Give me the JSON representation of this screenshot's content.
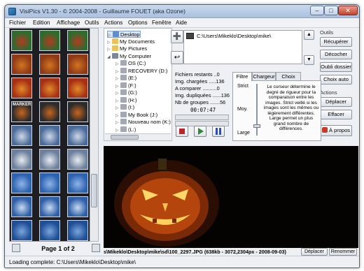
{
  "window": {
    "title": "VisiPics V1.30 - © 2004-2008 - Guillaume FOUET (aka Ozone)",
    "minimize": "–",
    "maximize": "□",
    "close": "✕"
  },
  "menu": [
    "Fichier",
    "Edition",
    "Affichage",
    "Outils",
    "Actions",
    "Options",
    "Fenêtre",
    "Aide"
  ],
  "thumbnails": {
    "marker_label": "MARKER",
    "page_label": "Page 1 of 2"
  },
  "tree": {
    "items": [
      {
        "label": "Desktop",
        "icon": "desktop-icon",
        "color": "#5b8fcf"
      },
      {
        "label": "My Documents",
        "icon": "folder-icon",
        "color": "#e9c45a"
      },
      {
        "label": "My Pictures",
        "icon": "folder-icon",
        "color": "#e9c45a"
      },
      {
        "label": "My Computer",
        "icon": "computer-icon",
        "color": "#7a8797"
      },
      {
        "label": "OS (C:)",
        "icon": "drive-icon",
        "color": "#a2a9b3"
      },
      {
        "label": "RECOVERY (D:)",
        "icon": "drive-icon",
        "color": "#a2a9b3"
      },
      {
        "label": "(E:)",
        "icon": "drive-icon",
        "color": "#a2a9b3"
      },
      {
        "label": "(F:)",
        "icon": "drive-icon",
        "color": "#a2a9b3"
      },
      {
        "label": "(G:)",
        "icon": "drive-icon",
        "color": "#a2a9b3"
      },
      {
        "label": "(H:)",
        "icon": "drive-icon",
        "color": "#a2a9b3"
      },
      {
        "label": "(I:)",
        "icon": "drive-icon",
        "color": "#a2a9b3"
      },
      {
        "label": "My Book (J:)",
        "icon": "drive-icon",
        "color": "#a2a9b3"
      },
      {
        "label": "Nouveau nom (K:)",
        "icon": "drive-icon",
        "color": "#a2a9b3"
      },
      {
        "label": "(L:)",
        "icon": "drive-icon",
        "color": "#a2a9b3"
      }
    ]
  },
  "path": {
    "value": "C:\\Users\\Mikeklo\\Desktop\\mike\\"
  },
  "outils": {
    "heading": "Outils",
    "buttons": [
      "Récupérer",
      "Décocher",
      "Oubli dossier",
      "Choix auto"
    ]
  },
  "actions": {
    "heading": "Actions",
    "buttons": [
      "Déplacer",
      "Effacer"
    ],
    "about": "À propos"
  },
  "stats": {
    "restants": "Fichiers restants ..0",
    "chargees": "Img. chargées .....136",
    "comparer": "A comparer ..........0",
    "dupliquees": "Img. dupliquées ......136",
    "groupes": "Nb de groupes .......56",
    "timer": "00:07:47"
  },
  "tabs": {
    "items": [
      "Filtre",
      "Chargeur",
      "Choix auto"
    ],
    "active": "Filtre",
    "levels": [
      "Strict",
      "Moy.",
      "Large"
    ],
    "description": "Le curseur détermine le degré de rigueur pour la comparaison entre les images. Strict veillé si les images sont les mêmes ou légèrement différentes. Large permet un plus grand nombre de différences."
  },
  "preview": {
    "info": "s\\Mikeklo\\Desktop\\mike\\sd\\100_2297.JPG (638kb - 3072,2304px - 2008-09-03)",
    "move": "Déplacer",
    "rename": "Renommer"
  },
  "status": {
    "text": "Loading complete: C:\\Users\\Mikeklo\\Desktop\\mike\\"
  },
  "colors": {
    "accent": "#3b6fb6",
    "stop": "#b8262a",
    "play": "#2d8a36",
    "pause": "#2b4eb8",
    "pumpkin": "#e0731d"
  }
}
